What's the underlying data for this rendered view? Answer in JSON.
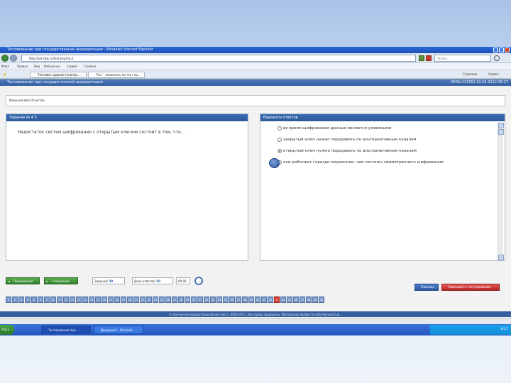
{
  "window": {
    "title": "Тестирование при государственной аккредитации - Windows Internet Explorer"
  },
  "address": {
    "url": "http://ast-rtpk.ru/test.php?id=1"
  },
  "search": {
    "placeholder": "Yandex"
  },
  "menu": {
    "items": [
      "Файл",
      "Правка",
      "Вид",
      "Избранное",
      "Сервис",
      "Справка"
    ]
  },
  "tabs": [
    {
      "label": "Тестовое задание (кнопки..."
    },
    {
      "label": "Тест - заполнить ли тест пр..."
    }
  ],
  "tools": {
    "page": "Страница",
    "service": "Сервис"
  },
  "app": {
    "header_title": "Тестирование при государственной аккредитации",
    "timestamp": "0006с113559 22.05.2012 08:37",
    "user_text": "Фамилия Имя Отчество"
  },
  "task": {
    "head": "Задание № 4 3.",
    "question": "Недостаток систем шифрования с открытым ключом состоит в том, что…"
  },
  "answers": {
    "head": "Варианты ответов",
    "options": [
      {
        "text": "во время шифрования данные являются уязвимыми",
        "selected": false
      },
      {
        "text": "закрытый ключ нужно передавать по альтернативным каналам",
        "selected": false
      },
      {
        "text": "открытый ключ нужно передавать по альтернативным каналам",
        "selected": true
      },
      {
        "text": "они работают гораздо медленнее, чем системы симметричного шифрования",
        "selected": false
      }
    ]
  },
  "controls": {
    "prev": "Предыдущее",
    "next": "Следующее",
    "total_label": "Заданий:",
    "total_value": "50",
    "answered_label": "Дано ответов:",
    "answered_value": "50",
    "timer": "00:00",
    "help": "Помощь",
    "finish": "Завершить тестирование"
  },
  "pager": {
    "pages": [
      "1",
      "2",
      "3",
      "4",
      "5",
      "6",
      "7",
      "8",
      "9",
      "10",
      "11",
      "12",
      "13",
      "14",
      "15",
      "16",
      "17",
      "18",
      "19",
      "20",
      "21",
      "22",
      "23",
      "24",
      "25",
      "26",
      "27",
      "28",
      "29",
      "30",
      "31",
      "32",
      "33",
      "34",
      "35",
      "36",
      "37",
      "38",
      "39",
      "40",
      "41",
      "42",
      "43",
      "44",
      "45",
      "46",
      "47",
      "48",
      "49",
      "50"
    ],
    "current": "43"
  },
  "footer": "© Научно-исследовательский институт, 2002-2011. Все права защищены. Материалы являются собственностью...",
  "taskbar": {
    "start": "Пуск",
    "tasks": [
      "Тестирование при ...",
      "Документ1 - Microsof..."
    ],
    "clock": "8:37"
  }
}
